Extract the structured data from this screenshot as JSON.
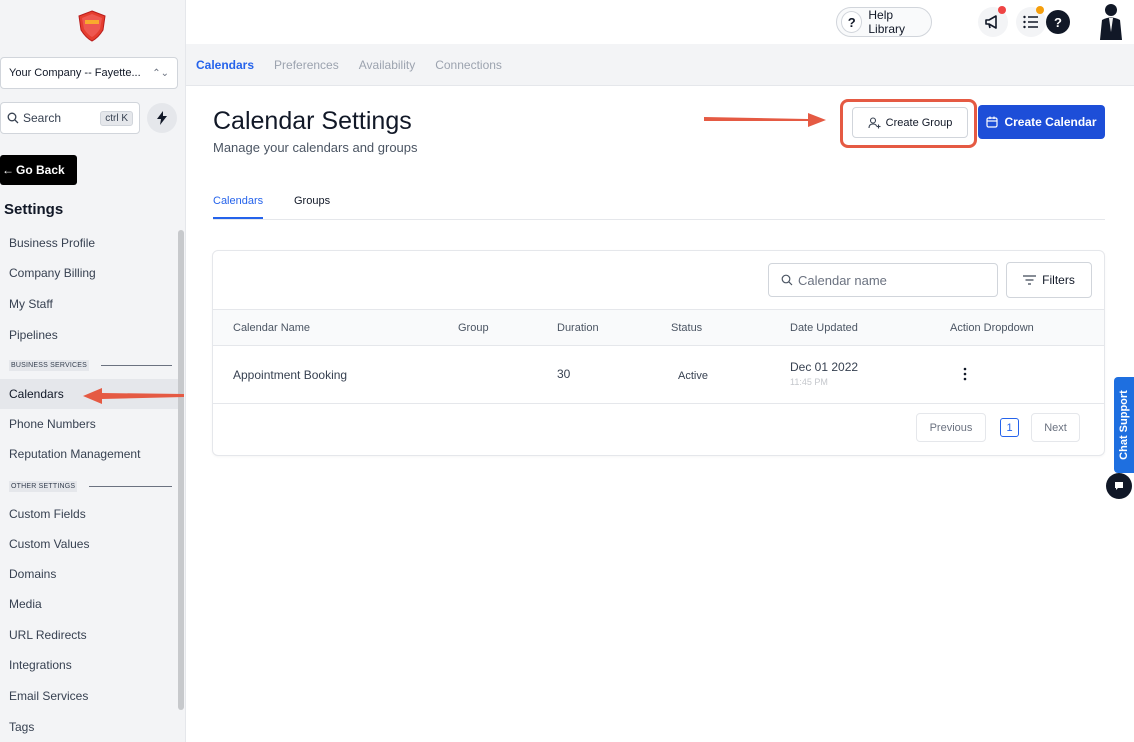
{
  "sidebar": {
    "company": "Your Company -- Fayette...",
    "search_label": "Search",
    "search_shortcut": "ctrl K",
    "go_back": "Go Back",
    "settings_title": "Settings",
    "items_top": [
      "Business Profile",
      "Company Billing",
      "My Staff",
      "Pipelines"
    ],
    "section_business": "BUSINESS SERVICES",
    "items_business": [
      "Calendars",
      "Phone Numbers",
      "Reputation Management"
    ],
    "section_other": "OTHER SETTINGS",
    "items_other": [
      "Custom Fields",
      "Custom Values",
      "Domains",
      "Media",
      "URL Redirects",
      "Integrations",
      "Email Services",
      "Tags"
    ]
  },
  "topbar": {
    "help_library": "Help Library",
    "help_q": "?",
    "help_circle": "?",
    "notification_dot_color": "#ef4444",
    "list_dot_color": "#f59e0b"
  },
  "subnav": {
    "tabs": [
      "Calendars",
      "Preferences",
      "Availability",
      "Connections"
    ]
  },
  "main": {
    "title": "Calendar Settings",
    "subtitle": "Manage your calendars and groups",
    "create_group": "Create Group",
    "create_calendar": "Create Calendar",
    "tabs": [
      "Calendars",
      "Groups"
    ],
    "search_placeholder": "Calendar name",
    "filters": "Filters",
    "columns": [
      "Calendar Name",
      "Group",
      "Duration",
      "Status",
      "Date Updated",
      "Action Dropdown"
    ],
    "rows": [
      {
        "name": "Appointment Booking",
        "group": "",
        "duration": "30",
        "status": "Active",
        "date": "Dec 01 2022",
        "time": "11:45 PM"
      }
    ],
    "pager": {
      "previous": "Previous",
      "page": "1",
      "next": "Next"
    }
  },
  "chat": {
    "label": "Chat Support"
  },
  "colors": {
    "accent": "#2563eb",
    "primary_button": "#1d4ed8",
    "annotation": "#e55a43"
  }
}
